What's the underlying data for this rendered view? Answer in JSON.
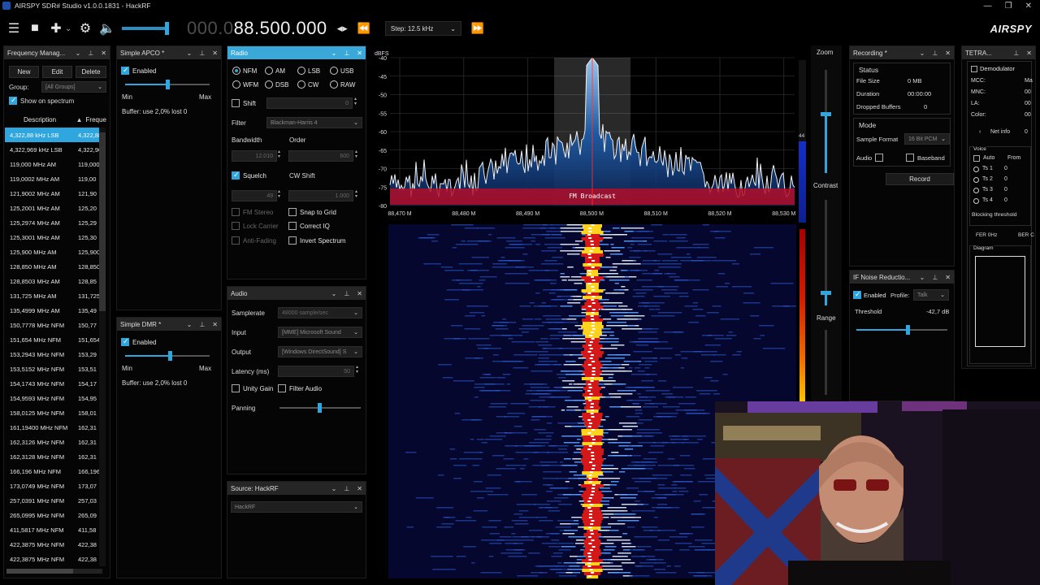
{
  "window": {
    "title": "AIRSPY SDR# Studio v1.0.0.1831 - HackRF"
  },
  "toolbar": {
    "freq_dim": "000.0",
    "freq_bright": "88.500.000",
    "step": "Step: 12.5 kHz",
    "logo": "AIRSPY"
  },
  "freq_manager": {
    "title": "Frequency Manag...",
    "new": "New",
    "edit": "Edit",
    "delete": "Delete",
    "group_label": "Group:",
    "group_value": "[All Groups]",
    "show_on_spectrum": "Show on spectrum",
    "col_description": "Description",
    "col_frequency": "Freque",
    "rows": [
      {
        "d": "4,322,88 kHz LSB",
        "f": "4,322,88"
      },
      {
        "d": "4,322,969 kHz LSB",
        "f": "4,322,96"
      },
      {
        "d": "119,000 MHz AM",
        "f": "119,000"
      },
      {
        "d": "119,0002 MHz AM",
        "f": "119,00"
      },
      {
        "d": "121,9002 MHz AM",
        "f": "121,90"
      },
      {
        "d": "125,2001 MHz AM",
        "f": "125,20"
      },
      {
        "d": "125,2974 MHz AM",
        "f": "125,29"
      },
      {
        "d": "125,3001 MHz AM",
        "f": "125,30"
      },
      {
        "d": "125,900 MHz AM",
        "f": "125,900"
      },
      {
        "d": "128,850 MHz AM",
        "f": "128,850"
      },
      {
        "d": "128,8503 MHz AM",
        "f": "128,85"
      },
      {
        "d": "131,725 MHz AM",
        "f": "131,725"
      },
      {
        "d": "135,4999 MHz AM",
        "f": "135,49"
      },
      {
        "d": "150,7778 MHz NFM",
        "f": "150,77"
      },
      {
        "d": "151,654 MHz NFM",
        "f": "151,654"
      },
      {
        "d": "153,2943 MHz NFM",
        "f": "153,29"
      },
      {
        "d": "153,5152 MHz NFM",
        "f": "153,51"
      },
      {
        "d": "154,1743 MHz NFM",
        "f": "154,17"
      },
      {
        "d": "154,9593 MHz NFM",
        "f": "154,95"
      },
      {
        "d": "158,0125 MHz NFM",
        "f": "158,01"
      },
      {
        "d": "161,19400 MHz NFM",
        "f": "162,31"
      },
      {
        "d": "162,3126 MHz NFM",
        "f": "162,31"
      },
      {
        "d": "162,3128 MHz NFM",
        "f": "162,31"
      },
      {
        "d": "166,196 MHz NFM",
        "f": "166,196"
      },
      {
        "d": "173,0749 MHz NFM",
        "f": "173,07"
      },
      {
        "d": "257,0391 MHz NFM",
        "f": "257,03"
      },
      {
        "d": "265,0995 MHz NFM",
        "f": "265,09"
      },
      {
        "d": "411,5817 MHz NFM",
        "f": "411,58"
      },
      {
        "d": "422,3875 MHz NFM",
        "f": "422,38"
      },
      {
        "d": "422,3875 MHz NFM",
        "f": "422,38"
      }
    ]
  },
  "apco": {
    "title": "Simple APCO *",
    "enabled": "Enabled",
    "min": "Min",
    "max": "Max",
    "buffer": "Buffer: use 2,0% lost 0",
    "slider_level": 0.5
  },
  "dmr": {
    "title": "Simple DMR *",
    "enabled": "Enabled",
    "min": "Min",
    "max": "Max",
    "buffer": "Buffer: use 2,0% lost 0",
    "slider_level": 0.53
  },
  "radio": {
    "title": "Radio",
    "modes": [
      "NFM",
      "AM",
      "LSB",
      "USB",
      "WFM",
      "DSB",
      "CW",
      "RAW"
    ],
    "selected_mode": "NFM",
    "shift": "Shift",
    "shift_value": "0",
    "filter": "Filter",
    "filter_value": "Blackman-Harris 4",
    "bandwidth": "Bandwidth",
    "order": "Order",
    "bandwidth_value": "12.010",
    "order_value": "600",
    "squelch": "Squelch",
    "cw_shift": "CW Shift",
    "squelch_value": "49",
    "cw_value": "1.000",
    "fm_stereo": "FM Stereo",
    "snap_to_grid": "Snap to Grid",
    "lock_carrier": "Lock Carrier",
    "correct_iq": "Correct IQ",
    "anti_fading": "Anti-Fading",
    "invert_spectrum": "Invert Spectrum"
  },
  "audio": {
    "title": "Audio",
    "samplerate": "Samplerate",
    "samplerate_value": "48000 sample/sec",
    "input": "Input",
    "input_value": "[MME] Microsoft Sound",
    "output": "Output",
    "output_value": "[Windows DirectSound] S",
    "latency": "Latency (ms)",
    "latency_value": "50",
    "unity_gain": "Unity Gain",
    "filter_audio": "Filter Audio",
    "panning": "Panning"
  },
  "source": {
    "title": "Source: HackRF",
    "value": "HackRF"
  },
  "spectrum": {
    "unit": "dBFS",
    "y_ticks": [
      "-40",
      "-45",
      "-50",
      "-55",
      "-60",
      "-65",
      "-70",
      "-75",
      "-80"
    ],
    "x_ticks": [
      "88,470 M",
      "88,480 M",
      "88,490 M",
      "88,500 M",
      "88,510 M",
      "88,520 M",
      "88,530 M"
    ],
    "band_label": "FM Broadcast",
    "level_value": "44"
  },
  "side_controls": {
    "zoom": "Zoom",
    "contrast": "Contrast",
    "range": "Range"
  },
  "recording": {
    "title": "Recording *",
    "status": "Status",
    "file_size": "File Size",
    "file_size_value": "0 MB",
    "duration": "Duration",
    "duration_value": "00:00:00",
    "dropped": "Dropped Buffers",
    "dropped_value": "0",
    "mode": "Mode",
    "sample_format": "Sample Format",
    "sample_format_value": "16 Bit PCM",
    "audio": "Audio",
    "baseband": "Baseband",
    "record": "Record"
  },
  "noise": {
    "title": "IF Noise Reductio...",
    "enabled": "Enabled",
    "profile": "Profile:",
    "profile_value": "Talk",
    "threshold": "Threshold",
    "threshold_value": "-42,7 dB",
    "slider_level": 0.56
  },
  "tetra": {
    "title": "TETRA...",
    "demodulator": "Demodulator",
    "mcc": "MCC:",
    "mcc_value": "Ma",
    "mnc": "MNC:",
    "mnc_value": "00",
    "la": "LA:",
    "la_value": "00",
    "color": "Color:",
    "color_value": "00",
    "net_info": "Net info",
    "net_info_value": "0",
    "voice": "Voice",
    "auto": "Auto",
    "from": "From",
    "ts": [
      {
        "label": "Ts 1",
        "value": "0"
      },
      {
        "label": "Ts 2",
        "value": "0"
      },
      {
        "label": "Ts 3",
        "value": "0"
      },
      {
        "label": "Ts 4",
        "value": "0"
      }
    ],
    "blocking": "Blocking threshold",
    "fer": "FER 0Hz",
    "ber": "BER C",
    "diagram": "Diagram"
  },
  "colors": {
    "accent": "#2fa6de",
    "band": "#b30e2a"
  }
}
